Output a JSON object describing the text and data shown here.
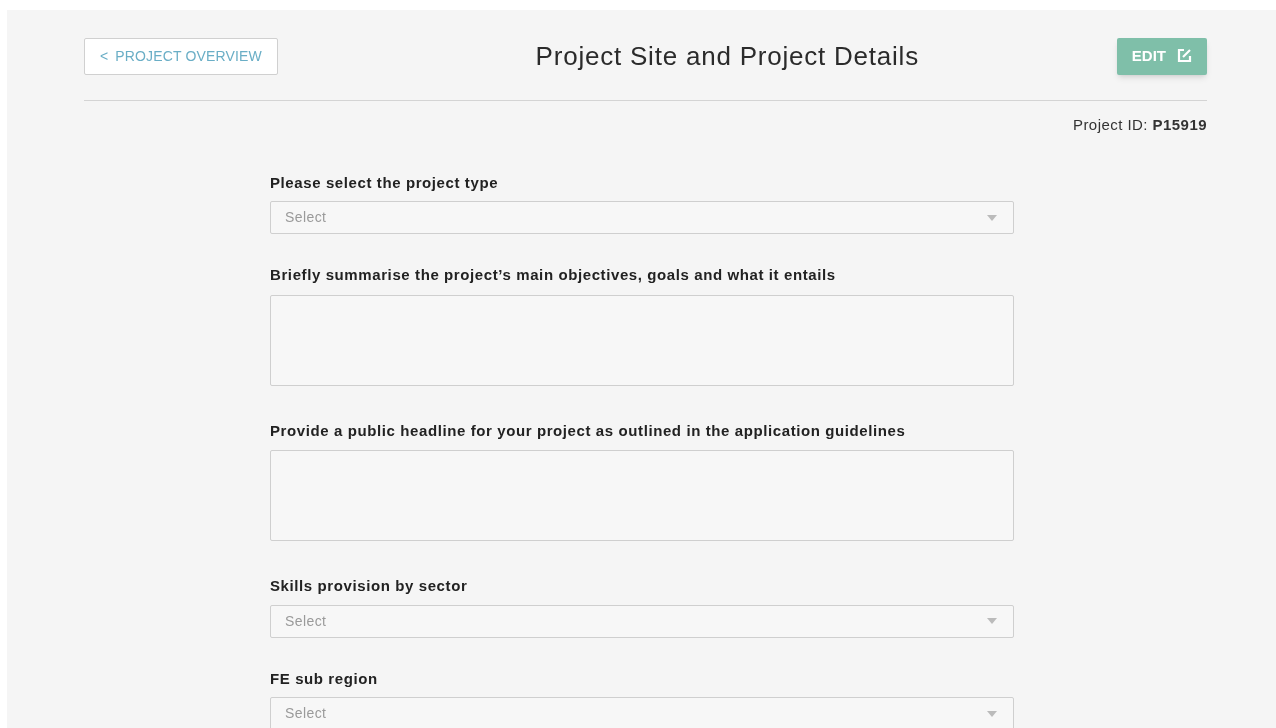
{
  "back_button": {
    "icon": "<",
    "label": "PROJECT OVERVIEW"
  },
  "title": "Project Site and Project Details",
  "edit_button": {
    "label": "EDIT"
  },
  "project_id": {
    "label": "Project ID:",
    "value": "P15919"
  },
  "fields": [
    {
      "kind": "select",
      "label": "Please select the project type",
      "placeholder": "Select"
    },
    {
      "kind": "textarea",
      "label": "Briefly summarise the project’s main objectives, goals and what it entails"
    },
    {
      "kind": "textarea",
      "label": "Provide a public headline for your project as outlined in the application guidelines"
    },
    {
      "kind": "select",
      "label": "Skills provision by sector",
      "placeholder": "Select"
    },
    {
      "kind": "select",
      "label": "FE sub region",
      "placeholder": "Select"
    }
  ]
}
